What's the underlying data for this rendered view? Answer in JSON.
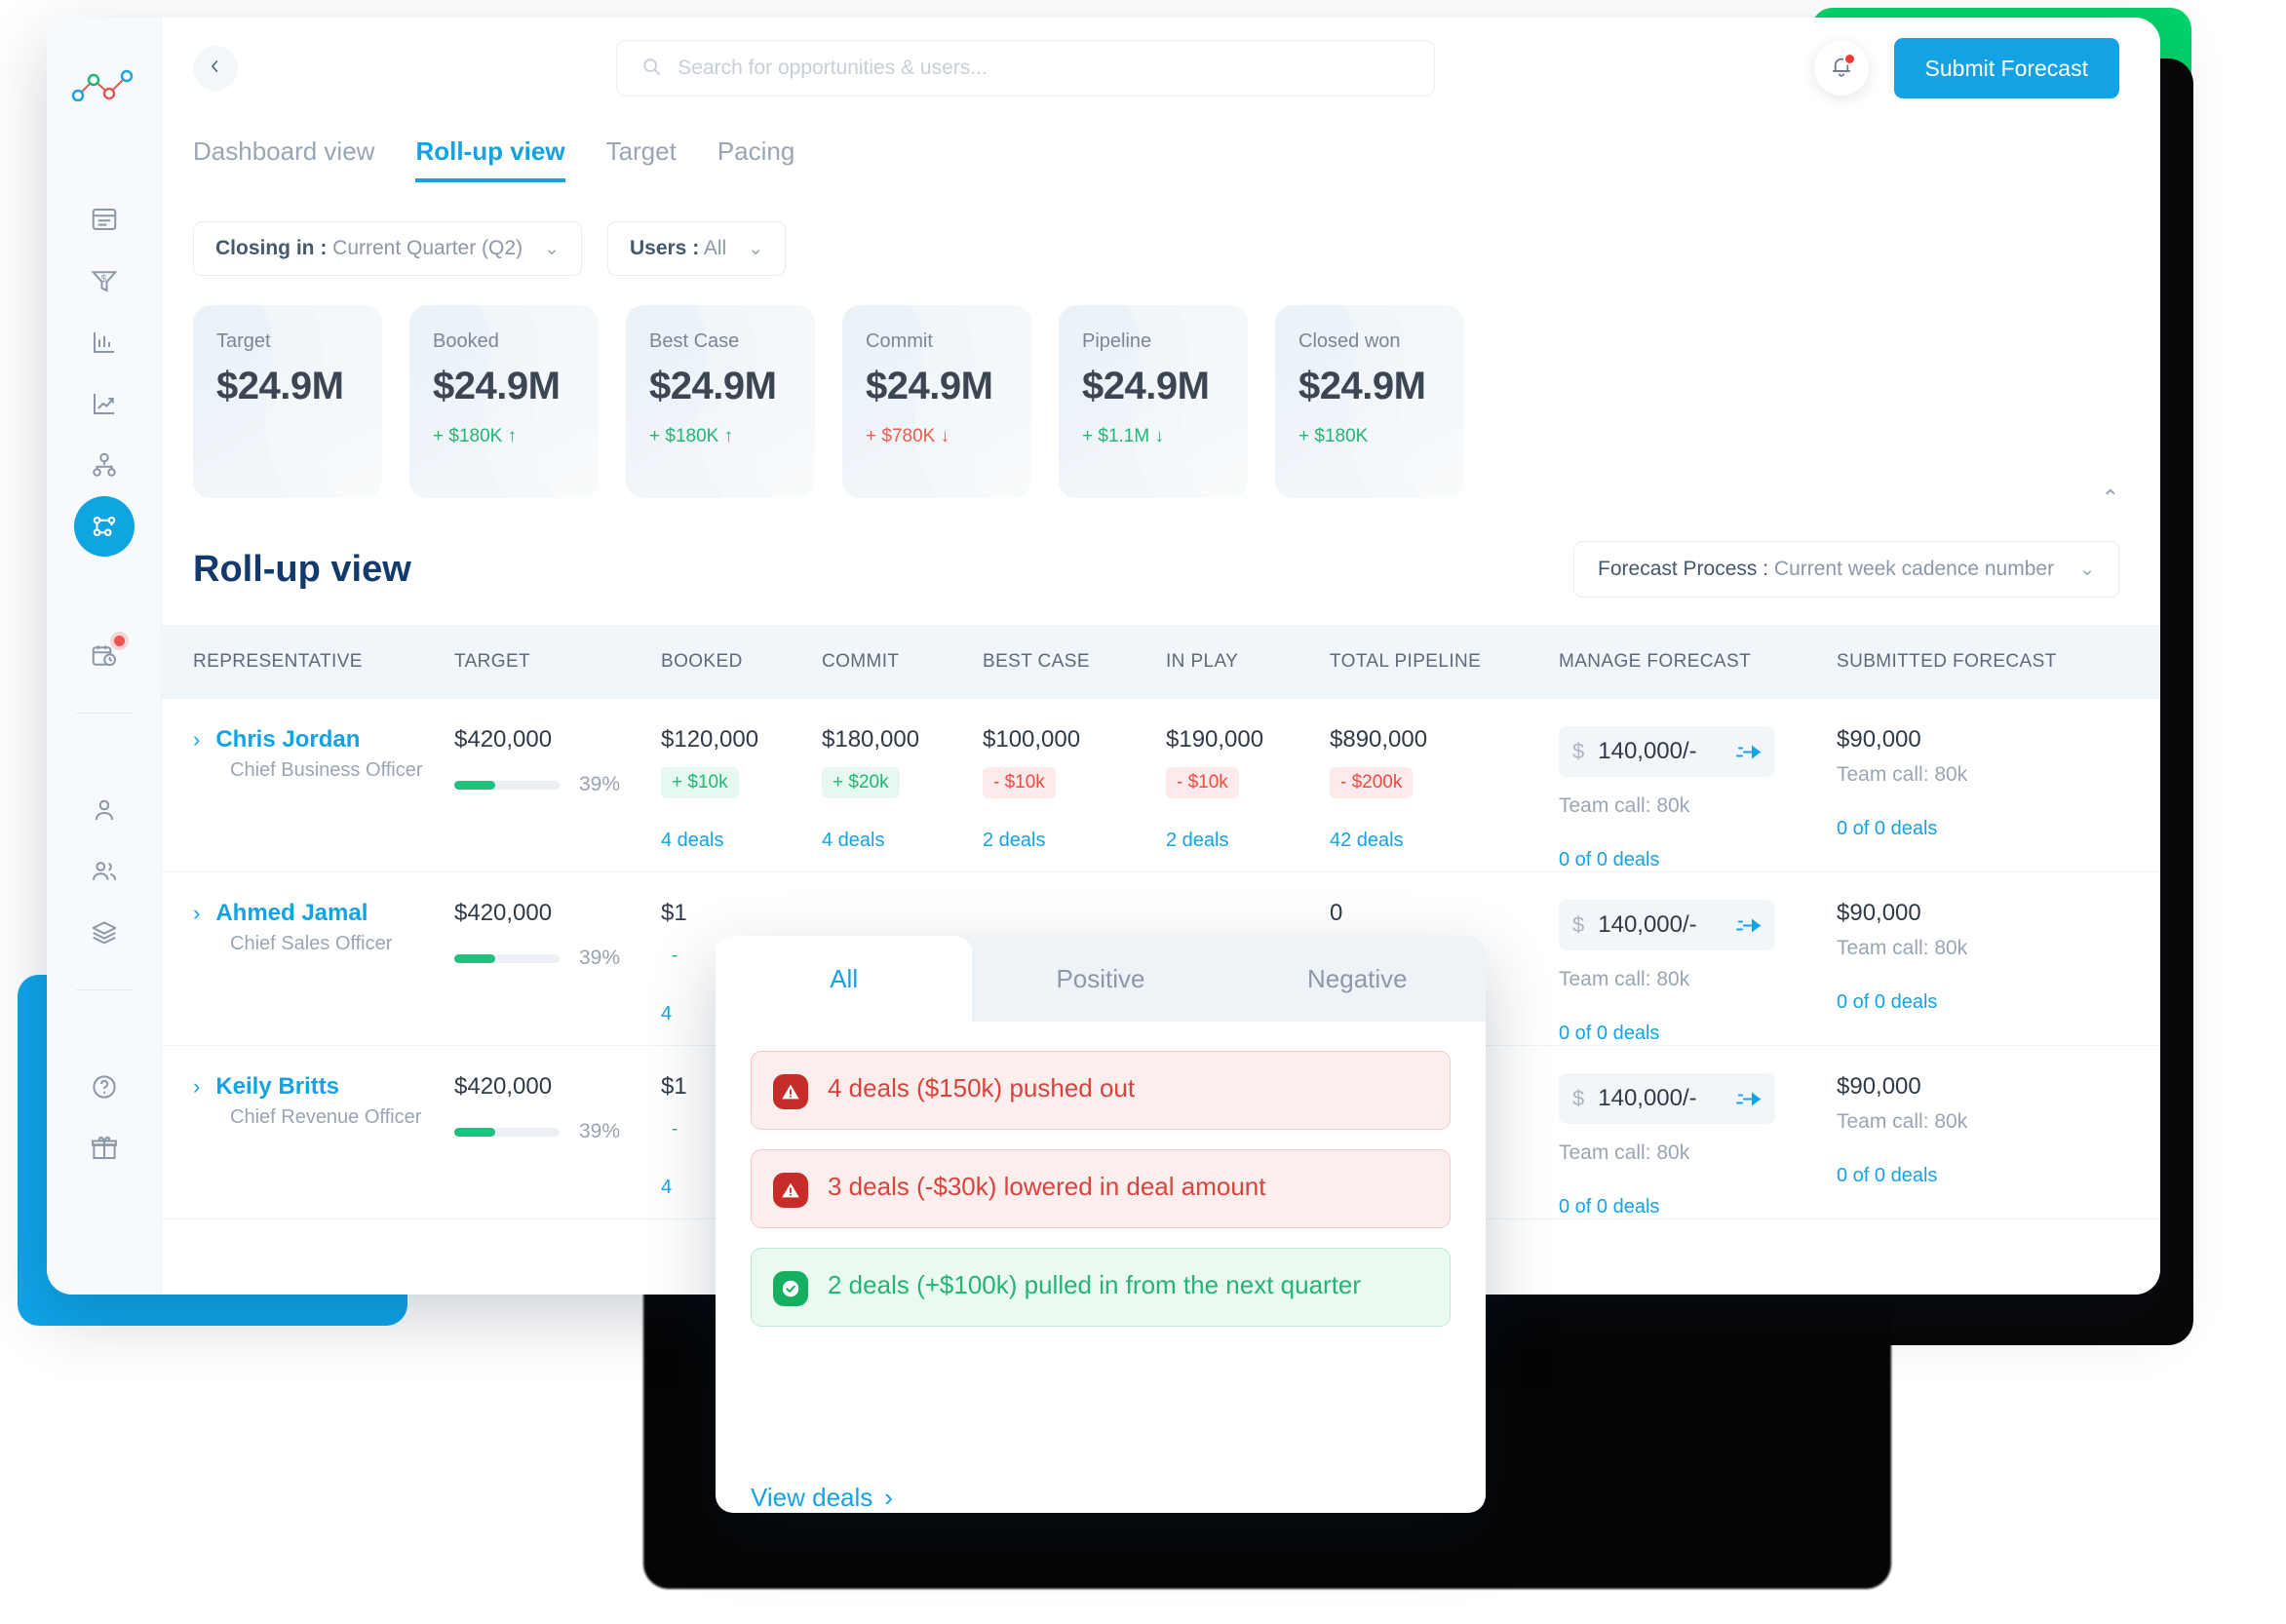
{
  "brand": {
    "accent": "#13a3e4",
    "heading": "#123a6d",
    "positive": "#22b573",
    "negative": "#ef4a43"
  },
  "topbar": {
    "back_icon": "chevron-left-icon",
    "search": {
      "placeholder": "Search for opportunities & users...",
      "value": ""
    },
    "notifications_icon": "bell-icon",
    "submit_label": "Submit Forecast"
  },
  "tabs": [
    {
      "label": "Dashboard view",
      "active": false
    },
    {
      "label": "Roll-up view",
      "active": true
    },
    {
      "label": "Target",
      "active": false
    },
    {
      "label": "Pacing",
      "active": false
    }
  ],
  "filters": [
    {
      "key": "Closing in :",
      "value": "Current Quarter (Q2)"
    },
    {
      "key": "Users :",
      "value": "All"
    }
  ],
  "kpis": [
    {
      "label": "Target",
      "value": "$24.9M",
      "delta": "",
      "arrow": "",
      "dir": ""
    },
    {
      "label": "Booked",
      "value": "$24.9M",
      "delta": "+ $180K",
      "arrow": "↑",
      "dir": "up"
    },
    {
      "label": "Best Case",
      "value": "$24.9M",
      "delta": "+ $180K",
      "arrow": "↑",
      "dir": "up"
    },
    {
      "label": "Commit",
      "value": "$24.9M",
      "delta": "+ $780K",
      "arrow": "↓",
      "dir": "down"
    },
    {
      "label": "Pipeline",
      "value": "$24.9M",
      "delta": "+ $1.1M",
      "arrow": "↓",
      "dir": "up"
    },
    {
      "label": "Closed won",
      "value": "$24.9M",
      "delta": "+ $180K",
      "arrow": "",
      "dir": "up"
    }
  ],
  "section": {
    "title": "Roll-up view",
    "process_filter": {
      "key": "Forecast Process :",
      "value": "Current week cadence number"
    }
  },
  "table": {
    "columns": [
      "REPRESENTATIVE",
      "TARGET",
      "BOOKED",
      "COMMIT",
      "BEST CASE",
      "IN PLAY",
      "TOTAL PIPELINE",
      "MANAGE FORECAST",
      "SUBMITTED FORECAST"
    ],
    "rows": [
      {
        "name": "Chris Jordan",
        "role": "Chief Business Officer",
        "target": "$420,000",
        "progress_pct": "39%",
        "progress_value": 39,
        "booked": {
          "amount": "$120,000",
          "chip": "+ $10k",
          "chip_dir": "pos",
          "deals": "4 deals"
        },
        "commit": {
          "amount": "$180,000",
          "chip": "+ $20k",
          "chip_dir": "pos",
          "deals": "4 deals"
        },
        "best_case": {
          "amount": "$100,000",
          "chip": "- $10k",
          "chip_dir": "neg",
          "deals": "2 deals"
        },
        "in_play": {
          "amount": "$190,000",
          "chip": "- $10k",
          "chip_dir": "neg",
          "deals": "2 deals"
        },
        "pipeline": {
          "amount": "$890,000",
          "chip": "- $200k",
          "chip_dir": "neg",
          "deals": "42 deals"
        },
        "manage": {
          "currency": "$",
          "value": "140,000/-",
          "team_call": "Team call: 80k",
          "deals": "0 of 0 deals"
        },
        "submitted": {
          "amount": "$90,000",
          "team_call": "Team call: 80k",
          "deals": "0 of 0 deals"
        }
      },
      {
        "name": "Ahmed Jamal",
        "role": "Chief Sales Officer",
        "target": "$420,000",
        "progress_pct": "39%",
        "progress_value": 39,
        "booked": {
          "amount": "$1",
          "chip": "-",
          "chip_dir": "pos",
          "deals": "4"
        },
        "commit": {
          "amount": "",
          "chip": "",
          "chip_dir": "pos",
          "deals": ""
        },
        "best_case": {
          "amount": "",
          "chip": "",
          "chip_dir": "neg",
          "deals": ""
        },
        "in_play": {
          "amount": "",
          "chip": "",
          "chip_dir": "neg",
          "deals": ""
        },
        "pipeline": {
          "amount": "0",
          "chip": "",
          "chip_dir": "neg",
          "deals": ""
        },
        "manage": {
          "currency": "$",
          "value": "140,000/-",
          "team_call": "Team call: 80k",
          "deals": "0 of 0 deals"
        },
        "submitted": {
          "amount": "$90,000",
          "team_call": "Team call: 80k",
          "deals": "0 of 0 deals"
        }
      },
      {
        "name": "Keily Britts",
        "role": "Chief Revenue Officer",
        "target": "$420,000",
        "progress_pct": "39%",
        "progress_value": 39,
        "booked": {
          "amount": "$1",
          "chip": "-",
          "chip_dir": "pos",
          "deals": "4"
        },
        "commit": {
          "amount": "",
          "chip": "",
          "chip_dir": "pos",
          "deals": ""
        },
        "best_case": {
          "amount": "",
          "chip": "",
          "chip_dir": "neg",
          "deals": ""
        },
        "in_play": {
          "amount": "",
          "chip": "",
          "chip_dir": "neg",
          "deals": ""
        },
        "pipeline": {
          "amount": "",
          "chip": "",
          "chip_dir": "neg",
          "deals": ""
        },
        "manage": {
          "currency": "$",
          "value": "140,000/-",
          "team_call": "Team call: 80k",
          "deals": "0 of 0 deals"
        },
        "submitted": {
          "amount": "$90,000",
          "team_call": "Team call: 80k",
          "deals": "0 of 0 deals"
        }
      }
    ]
  },
  "popover": {
    "tabs": [
      {
        "label": "All",
        "active": true
      },
      {
        "label": "Positive",
        "active": false
      },
      {
        "label": "Negative",
        "active": false
      }
    ],
    "alerts": [
      {
        "text": "4 deals ($150k) pushed out",
        "type": "neg",
        "icon": "warning-icon"
      },
      {
        "text": "3 deals (-$30k) lowered in deal amount",
        "type": "neg",
        "icon": "warning-icon"
      },
      {
        "text": "2 deals (+$100k) pulled in from the next quarter",
        "type": "pos",
        "icon": "check-circle-icon"
      }
    ],
    "footer_link": "View deals"
  },
  "sidebar": {
    "logo_icon": "line-chart-logo",
    "items": [
      {
        "name": "dashboard-icon",
        "active": false
      },
      {
        "name": "funnel-dollar-icon",
        "active": false
      },
      {
        "name": "bar-chart-icon",
        "active": false
      },
      {
        "name": "trend-up-icon",
        "active": false
      },
      {
        "name": "org-chart-icon",
        "active": false
      },
      {
        "name": "nodes-icon",
        "active": true
      },
      {
        "name": "calendar-clock-icon",
        "active": false,
        "badge": true
      },
      {
        "name": "user-icon",
        "active": false
      },
      {
        "name": "users-icon",
        "active": false
      },
      {
        "name": "layers-icon",
        "active": false
      },
      {
        "name": "help-circle-icon",
        "active": false
      },
      {
        "name": "gift-icon",
        "active": false
      }
    ]
  }
}
